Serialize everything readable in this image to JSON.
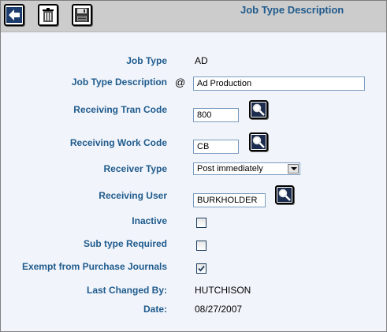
{
  "toolbar": {
    "buttons": [
      {
        "name": "back-button",
        "icon": "arrow-left-icon"
      },
      {
        "name": "delete-button",
        "icon": "trash-icon"
      },
      {
        "name": "save-button",
        "icon": "floppy-disk-icon"
      }
    ]
  },
  "header": {
    "title": "Job Type Description"
  },
  "form": {
    "job_type_label": "Job Type",
    "job_type_value": "AD",
    "job_type_desc_label": "Job Type Description",
    "job_type_desc_marker": "@",
    "job_type_desc_value": "Ad Production",
    "receiving_tran_code_label": "Receiving Tran Code",
    "receiving_tran_code_value": "800",
    "receiving_work_code_label": "Receiving Work Code",
    "receiving_work_code_value": "CB",
    "receiver_type_label": "Receiver Type",
    "receiver_type_value": "Post immediately",
    "receiving_user_label": "Receiving User",
    "receiving_user_value": "BURKHOLDER",
    "inactive_label": "Inactive",
    "inactive_checked": false,
    "sub_type_required_label": "Sub type Required",
    "sub_type_required_checked": false,
    "exempt_label": "Exempt from Purchase Journals",
    "exempt_checked": true,
    "last_changed_by_label": "Last Changed By:",
    "last_changed_by_value": "HUTCHISON",
    "date_label": "Date:",
    "date_value": "08/27/2007"
  },
  "colors": {
    "label_blue": "#1f5a8c",
    "toolbar_gray": "#cccccc",
    "page_background": "#f1f5fb"
  }
}
